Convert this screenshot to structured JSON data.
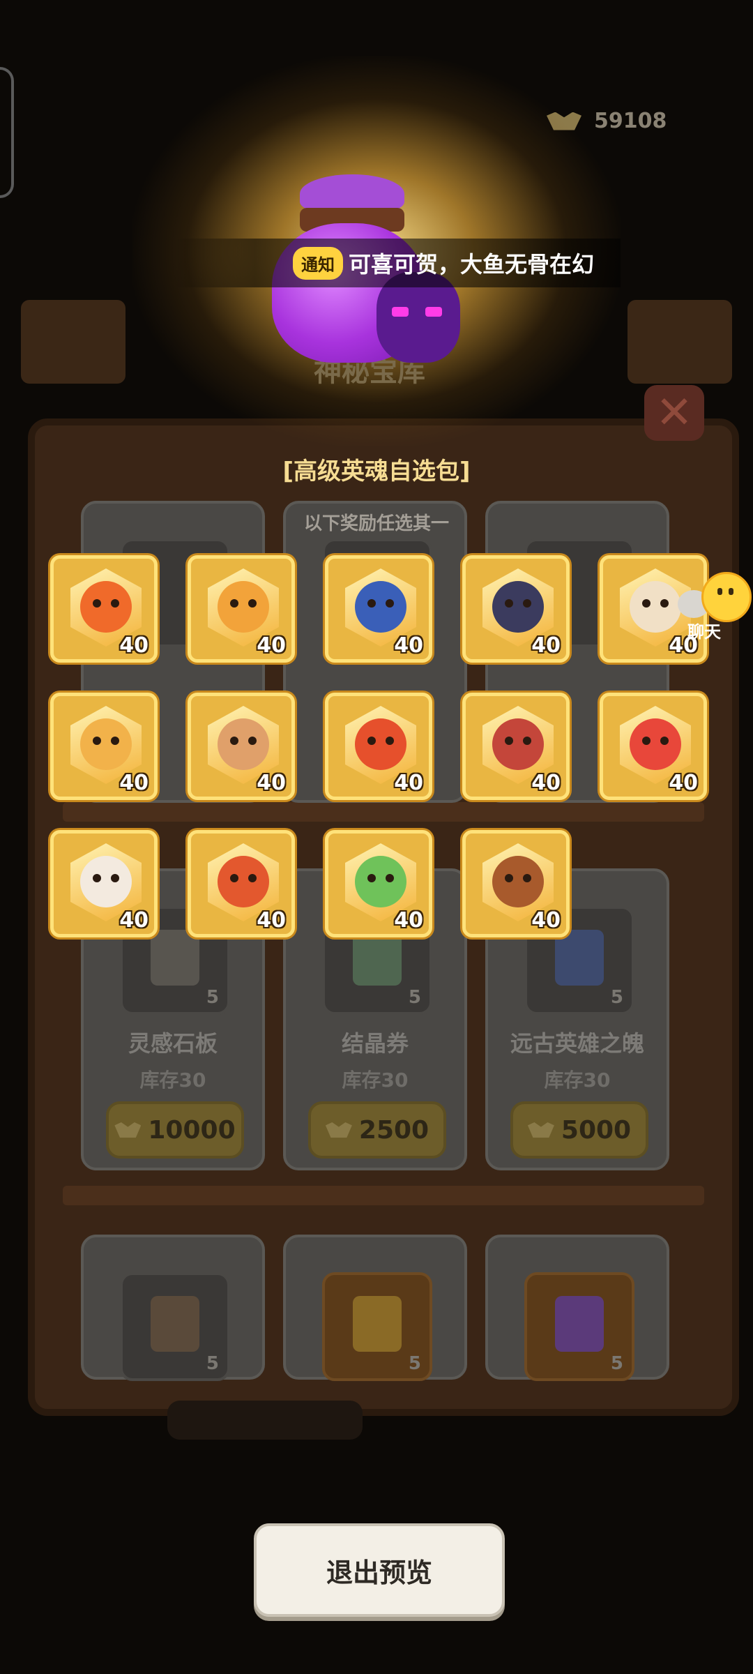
{
  "header": {
    "currency_value": "59108",
    "featured_title_faded": "神秘宝库"
  },
  "notice": {
    "tag": "通知",
    "message": "可喜可贺，大鱼无骨在幻"
  },
  "shop": {
    "items": [
      {
        "name": "灵感石板",
        "stock": "库存30",
        "price": "10000",
        "qty": "5"
      },
      {
        "name": "结晶券",
        "stock": "库存30",
        "price": "2500",
        "qty": "5"
      },
      {
        "name": "远古英雄之魄",
        "stock": "库存30",
        "price": "5000",
        "qty": "5"
      }
    ],
    "bottom_row_qty": [
      "5",
      "5",
      "5"
    ]
  },
  "popup": {
    "title": "[高级英魂自选包]",
    "subtitle": "以下奖励任选其一",
    "rewards": [
      {
        "count": "40",
        "color": "#f06a2a"
      },
      {
        "count": "40",
        "color": "#f2a33a"
      },
      {
        "count": "40",
        "color": "#3a5fb8"
      },
      {
        "count": "40",
        "color": "#3b3b5e"
      },
      {
        "count": "40",
        "color": "#f1e0c6"
      },
      {
        "count": "40",
        "color": "#f2b24a"
      },
      {
        "count": "40",
        "color": "#e0a06a"
      },
      {
        "count": "40",
        "color": "#e6502c"
      },
      {
        "count": "40",
        "color": "#c4463a"
      },
      {
        "count": "40",
        "color": "#e8473a"
      },
      {
        "count": "40",
        "color": "#f3eadf"
      },
      {
        "count": "40",
        "color": "#e3582e"
      },
      {
        "count": "40",
        "color": "#6fc25a"
      },
      {
        "count": "40",
        "color": "#a85a2c"
      }
    ]
  },
  "chat": {
    "label": "聊天"
  },
  "exit_button": {
    "label": "退出预览"
  }
}
